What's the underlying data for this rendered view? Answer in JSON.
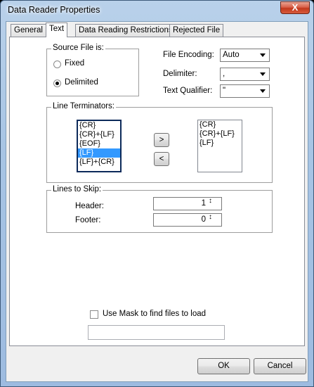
{
  "window": {
    "title": "Data Reader Properties",
    "close_glyph": "X"
  },
  "tabs": [
    {
      "label": "General"
    },
    {
      "label": "Text"
    },
    {
      "label": "Data Reading Restrictions"
    },
    {
      "label": "Rejected File"
    }
  ],
  "source_file": {
    "group_label": "Source File is:",
    "fixed_label": "Fixed",
    "delimited_label": "Delimited",
    "selected": "Delimited"
  },
  "file_encoding": {
    "label": "File Encoding:",
    "value": "Auto"
  },
  "delimiter": {
    "label": "Delimiter:",
    "value": ","
  },
  "text_qualifier": {
    "label": "Text Qualifier:",
    "value": "\""
  },
  "line_terminators": {
    "group_label": "Line Terminators:",
    "available": [
      "{CR}",
      "{CR}+{LF}",
      "{EOF}",
      "{LF}",
      "{LF}+{CR}"
    ],
    "selected_available": "{LF}",
    "chosen": [
      "{CR}",
      "{CR}+{LF}",
      "{LF}"
    ],
    "add_label": ">",
    "remove_label": "<"
  },
  "lines_to_skip": {
    "group_label": "Lines to Skip:",
    "header_label": "Header:",
    "header_value": "1",
    "footer_label": "Footer:",
    "footer_value": "0",
    "spin_glyph": "↕"
  },
  "mask": {
    "label": "Use Mask to find files to load",
    "checked": false,
    "value": ""
  },
  "buttons": {
    "ok": "OK",
    "cancel": "Cancel"
  }
}
